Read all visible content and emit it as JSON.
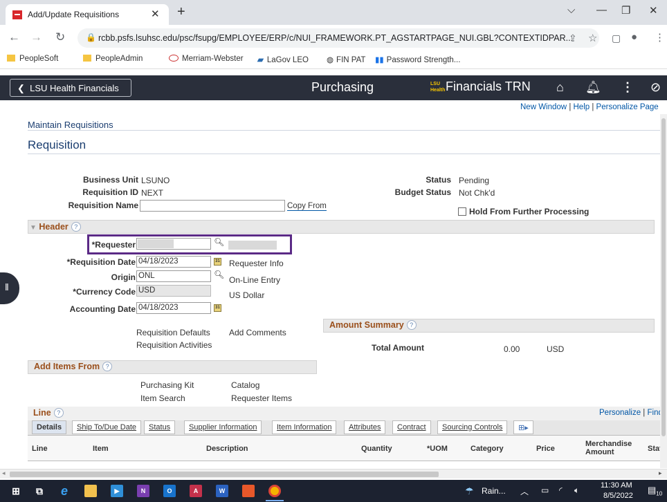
{
  "browser": {
    "tab_title": "Add/Update Requisitions",
    "url": "rcbb.psfs.lsuhsc.edu/psc/fsupg/EMPLOYEE/ERP/c/NUI_FRAMEWORK.PT_AGSTARTPAGE_NUI.GBL?CONTEXTIDPAR...",
    "bookmarks": [
      "PeopleSoft",
      "PeopleAdmin",
      "Merriam-Webster",
      "LaGov LEO",
      "FIN PAT",
      "Password Strength..."
    ]
  },
  "banner": {
    "back_label": "LSU Health Financials",
    "page_title": "Purchasing",
    "brand": "Financials TRN"
  },
  "toplinks": {
    "new_window": "New Window",
    "help": "Help",
    "personalize_page": "Personalize Page"
  },
  "breadcrumb": "Maintain Requisitions",
  "page_heading": "Requisition",
  "form": {
    "business_unit_label": "Business Unit",
    "business_unit": "LSUNO",
    "requisition_id_label": "Requisition ID",
    "requisition_id": "NEXT",
    "requisition_name_label": "Requisition Name",
    "requisition_name": "",
    "copy_from": "Copy From",
    "status_label": "Status",
    "status": "Pending",
    "budget_status_label": "Budget Status",
    "budget_status": "Not Chk'd",
    "hold_label": "Hold From Further Processing"
  },
  "header_section": {
    "title": "Header",
    "requester_label": "*Requester",
    "requester": "",
    "requisition_date_label": "*Requisition Date",
    "requisition_date": "04/18/2023",
    "requester_info": "Requester Info",
    "origin_label": "Origin",
    "origin": "ONL",
    "origin_desc": "On-Line Entry",
    "currency_label": "*Currency Code",
    "currency": "USD",
    "currency_desc": "US Dollar",
    "accounting_date_label": "Accounting Date",
    "accounting_date": "04/18/2023",
    "requisition_defaults": "Requisition Defaults",
    "add_comments": "Add Comments",
    "requisition_activities": "Requisition Activities"
  },
  "amount_summary": {
    "title": "Amount Summary",
    "total_label": "Total Amount",
    "total": "0.00",
    "currency": "USD"
  },
  "add_items": {
    "title": "Add Items From",
    "purchasing_kit": "Purchasing Kit",
    "catalog": "Catalog",
    "item_search": "Item Search",
    "requester_items": "Requester Items"
  },
  "line_section": {
    "title": "Line",
    "personalize": "Personalize",
    "find": "Find",
    "tabs": [
      "Details",
      "Ship To/Due Date",
      "Status",
      "Supplier Information",
      "Item Information",
      "Attributes",
      "Contract",
      "Sourcing Controls"
    ],
    "columns": [
      "Line",
      "Item",
      "Description",
      "Quantity",
      "*UOM",
      "Category",
      "Price",
      "Merchandise Amount",
      "Statu"
    ]
  },
  "taskbar": {
    "weather": "Rain...",
    "time": "11:30 AM",
    "date": "8/5/2022",
    "notification_count": "10"
  }
}
